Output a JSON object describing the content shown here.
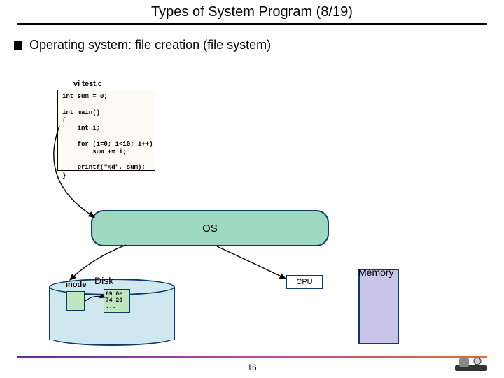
{
  "slide": {
    "title": "Types of System Program (8/19)",
    "bullet": "Operating system: file creation (file system)",
    "page_number": "16"
  },
  "code": {
    "filename": "vi test.c",
    "source": "int sum = 0;\n\nint main()\n{\n    int i;\n\n    for (i=0; i<10; i++)\n        sum += i;\n\n    printf(\"%d\", sum);\n}"
  },
  "diagram": {
    "os_label": "OS",
    "disk_label": "Disk",
    "inode_label": "inode",
    "data_block": "69 6e\n74 20\n...",
    "cpu_label": "CPU",
    "memory_label": "Memory"
  }
}
